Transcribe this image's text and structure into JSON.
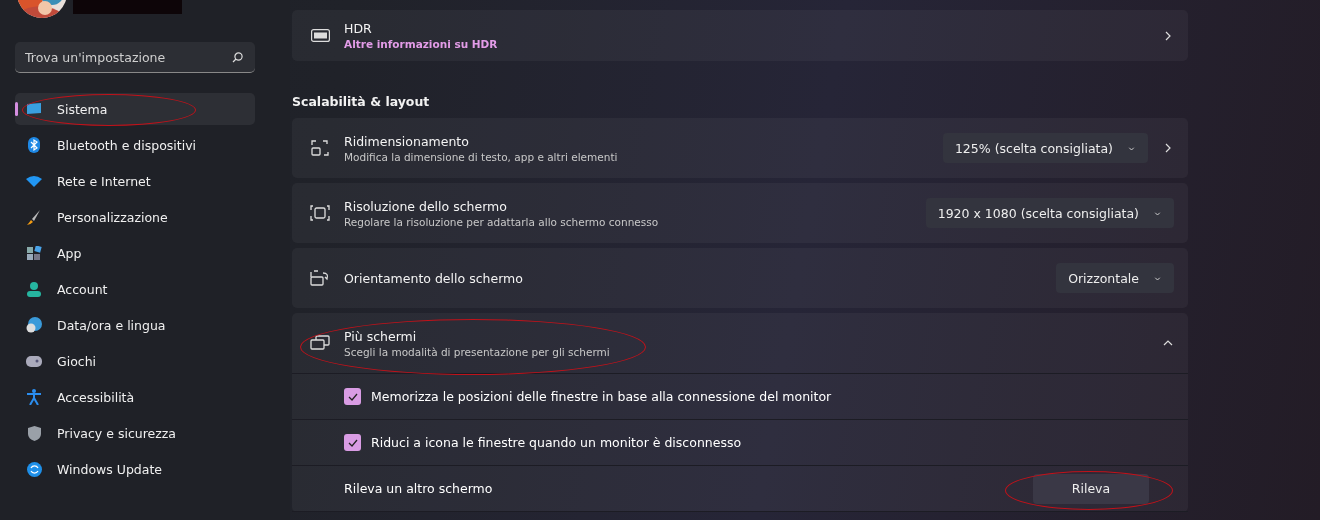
{
  "search": {
    "placeholder": "Trova un'impostazione"
  },
  "nav": [
    {
      "label": "Sistema",
      "selected": true,
      "circled": true
    },
    {
      "label": "Bluetooth e dispositivi",
      "selected": false,
      "circled": false
    },
    {
      "label": "Rete e Internet",
      "selected": false,
      "circled": false
    },
    {
      "label": "Personalizzazione",
      "selected": false,
      "circled": false
    },
    {
      "label": "App",
      "selected": false,
      "circled": false
    },
    {
      "label": "Account",
      "selected": false,
      "circled": false
    },
    {
      "label": "Data/ora e lingua",
      "selected": false,
      "circled": false
    },
    {
      "label": "Giochi",
      "selected": false,
      "circled": false
    },
    {
      "label": "Accessibilità",
      "selected": false,
      "circled": false
    },
    {
      "label": "Privacy e sicurezza",
      "selected": false,
      "circled": false
    },
    {
      "label": "Windows Update",
      "selected": false,
      "circled": false
    }
  ],
  "hdr": {
    "title": "HDR",
    "link": "Altre informazioni su HDR"
  },
  "section_title": "Scalabilità & layout",
  "settings": [
    {
      "title": "Ridimensionamento",
      "description": "Modifica la dimensione di testo, app e altri elementi",
      "dropdown": "125% (scelta consigliata)",
      "chevron": true
    },
    {
      "title": "Risoluzione dello schermo",
      "description": "Regolare la risoluzione per adattarla allo schermo connesso",
      "dropdown": "1920 x 1080 (scelta consigliata)",
      "chevron": false
    },
    {
      "title": "Orientamento dello schermo",
      "dropdown": "Orizzontale",
      "chevron": false
    }
  ],
  "multi": {
    "title": "Più schermi",
    "description": "Scegli la modalità di presentazione per gli schermi",
    "expanded": true,
    "circled": true,
    "options": [
      {
        "kind": "checkbox",
        "label": "Memorizza le posizioni delle finestre in base alla connessione del monitor",
        "checked": true
      },
      {
        "kind": "checkbox",
        "label": "Riduci a icona le finestre quando un monitor è disconnesso",
        "checked": true
      },
      {
        "kind": "button",
        "label": "Rileva un altro schermo",
        "button": "Rileva",
        "circled": true
      }
    ]
  }
}
